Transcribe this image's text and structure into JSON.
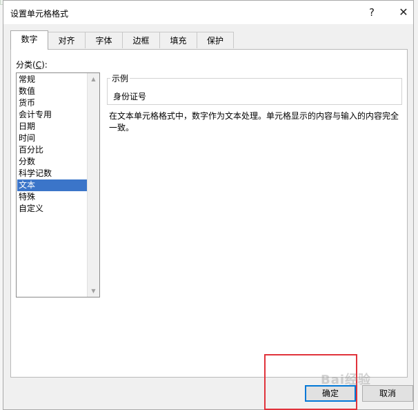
{
  "window": {
    "title": "设置单元格格式",
    "help_label": "?",
    "close_label": "✕"
  },
  "tabs": [
    {
      "label": "数字",
      "active": true
    },
    {
      "label": "对齐"
    },
    {
      "label": "字体"
    },
    {
      "label": "边框"
    },
    {
      "label": "填充"
    },
    {
      "label": "保护"
    }
  ],
  "category": {
    "label_prefix": "分类(",
    "label_key": "C",
    "label_suffix": "):",
    "items": [
      "常规",
      "数值",
      "货币",
      "会计专用",
      "日期",
      "时间",
      "百分比",
      "分数",
      "科学记数",
      "文本",
      "特殊",
      "自定义"
    ],
    "selected": "文本"
  },
  "sample": {
    "legend": "示例",
    "value": "身份证号"
  },
  "description": "在文本单元格格式中，数字作为文本处理。单元格显示的内容与输入的内容完全一致。",
  "buttons": {
    "ok": "确定",
    "cancel": "取消"
  },
  "watermark": "Bai经验",
  "colors": {
    "selected_bg": "#3b75c9",
    "default_button_border": "#0078d7",
    "annotation_red": "#e0323a"
  }
}
